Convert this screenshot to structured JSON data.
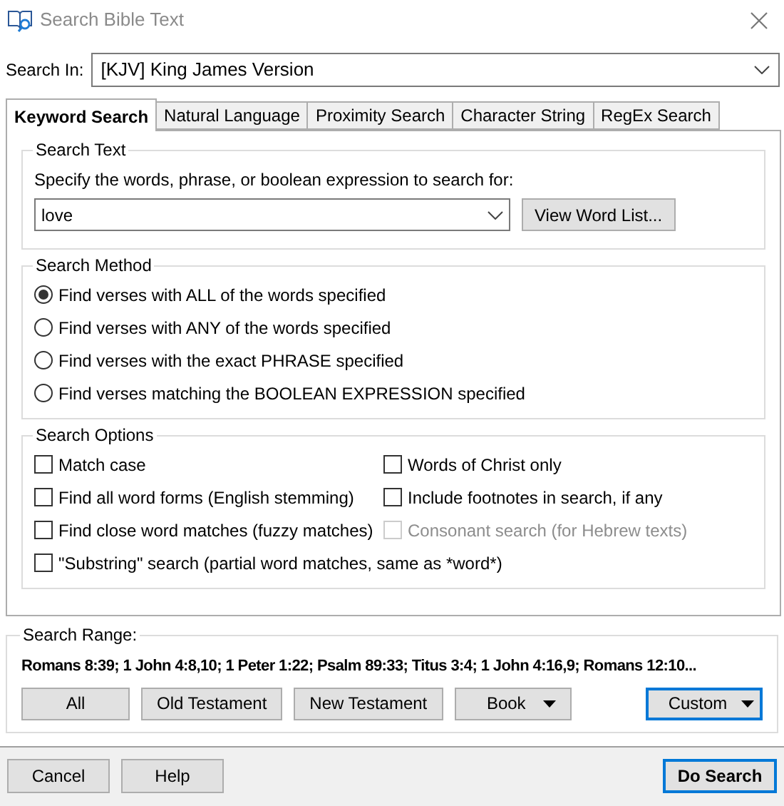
{
  "window": {
    "title": "Search Bible Text"
  },
  "search_in": {
    "label": "Search In:",
    "value": "[KJV] King James Version"
  },
  "tabs": [
    {
      "label": "Keyword Search",
      "selected": true
    },
    {
      "label": "Natural Language",
      "selected": false
    },
    {
      "label": "Proximity Search",
      "selected": false
    },
    {
      "label": "Character String",
      "selected": false
    },
    {
      "label": "RegEx Search",
      "selected": false
    }
  ],
  "search_text": {
    "title": "Search Text",
    "prompt": "Specify the words, phrase, or boolean expression to search for:",
    "value": "love",
    "button": "View Word List..."
  },
  "search_method": {
    "title": "Search Method",
    "options": [
      {
        "label": "Find verses with ALL of the words specified",
        "selected": true
      },
      {
        "label": "Find verses with ANY of the words specified",
        "selected": false
      },
      {
        "label": "Find verses with the exact PHRASE specified",
        "selected": false
      },
      {
        "label": "Find verses matching the BOOLEAN EXPRESSION specified",
        "selected": false
      }
    ]
  },
  "search_options": {
    "title": "Search Options",
    "left_column": [
      {
        "label": "Match case",
        "checked": false,
        "disabled": false
      },
      {
        "label": "Find all word forms (English stemming)",
        "checked": false,
        "disabled": false
      },
      {
        "label": "Find close word matches (fuzzy matches)",
        "checked": false,
        "disabled": false
      },
      {
        "label": "\"Substring\" search (partial word matches, same as *word*)",
        "checked": false,
        "disabled": false
      }
    ],
    "right_column": [
      {
        "label": "Words of Christ only",
        "checked": false,
        "disabled": false
      },
      {
        "label": "Include footnotes in search, if any",
        "checked": false,
        "disabled": false
      },
      {
        "label": "Consonant search (for Hebrew texts)",
        "checked": false,
        "disabled": true
      }
    ]
  },
  "search_range": {
    "title": "Search Range:",
    "value": "Romans 8:39; 1 John 4:8,10; 1 Peter 1:22; Psalm 89:33; Titus 3:4; 1 John 4:16,9; Romans 12:10...",
    "buttons": [
      {
        "label": "All",
        "kind": "plain",
        "focused": false
      },
      {
        "label": "Old Testament",
        "kind": "plain",
        "focused": false
      },
      {
        "label": "New Testament",
        "kind": "plain",
        "focused": false
      },
      {
        "label": "Book",
        "kind": "dropdown",
        "focused": false
      },
      {
        "label": "Custom",
        "kind": "dropdown",
        "focused": true
      }
    ]
  },
  "buttons": [
    {
      "label": "Cancel",
      "default": false
    },
    {
      "label": "Help",
      "default": false
    },
    {
      "label": "Do Search",
      "default": true
    }
  ]
}
